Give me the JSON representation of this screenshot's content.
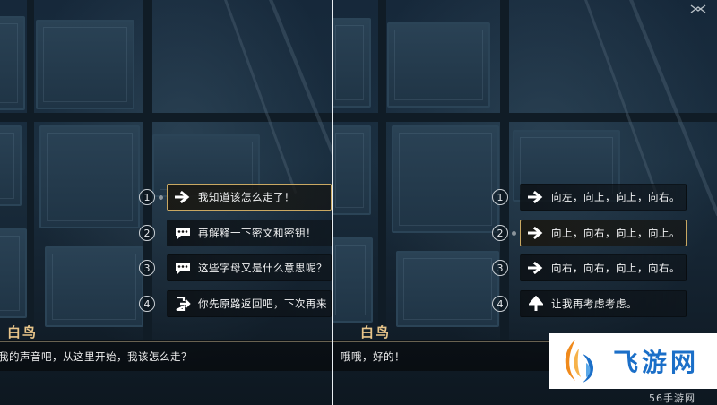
{
  "left_panel": {
    "options": [
      {
        "number": "1",
        "icon": "arrow-right-icon",
        "text": "我知道该怎么走了！",
        "selected": true
      },
      {
        "number": "2",
        "icon": "chat-bubble-icon",
        "text": "再解释一下密文和密钥！",
        "selected": false
      },
      {
        "number": "3",
        "icon": "chat-bubble-icon",
        "text": "这些字母又是什么意思呢？",
        "selected": false
      },
      {
        "number": "4",
        "icon": "exit-door-icon",
        "text": "你先原路返回吧，下次再来",
        "selected": false
      }
    ],
    "speaker": "白鸟",
    "dialogue": "我的声音吧，从这里开始，我该怎么走？"
  },
  "right_panel": {
    "options": [
      {
        "number": "1",
        "icon": "arrow-right-icon",
        "text": "向左，向上，向上，向右。",
        "selected": false
      },
      {
        "number": "2",
        "icon": "arrow-right-icon",
        "text": "向上，向右，向上，向上。",
        "selected": true
      },
      {
        "number": "3",
        "icon": "arrow-right-icon",
        "text": "向右，向右，向上，向右。",
        "selected": false
      },
      {
        "number": "4",
        "icon": "arrow-up-icon",
        "text": "让我再考虑考虑。",
        "selected": false
      }
    ],
    "speaker": "白鸟",
    "dialogue": "哦哦，好的！"
  },
  "watermark": {
    "brand": "飞游网",
    "sub": "56手游网"
  },
  "colors": {
    "selected_border": "#c9a862",
    "speaker": "#e8c58a",
    "watermark_blue": "#1b6fc8",
    "watermark_orange": "#f08a1c"
  }
}
